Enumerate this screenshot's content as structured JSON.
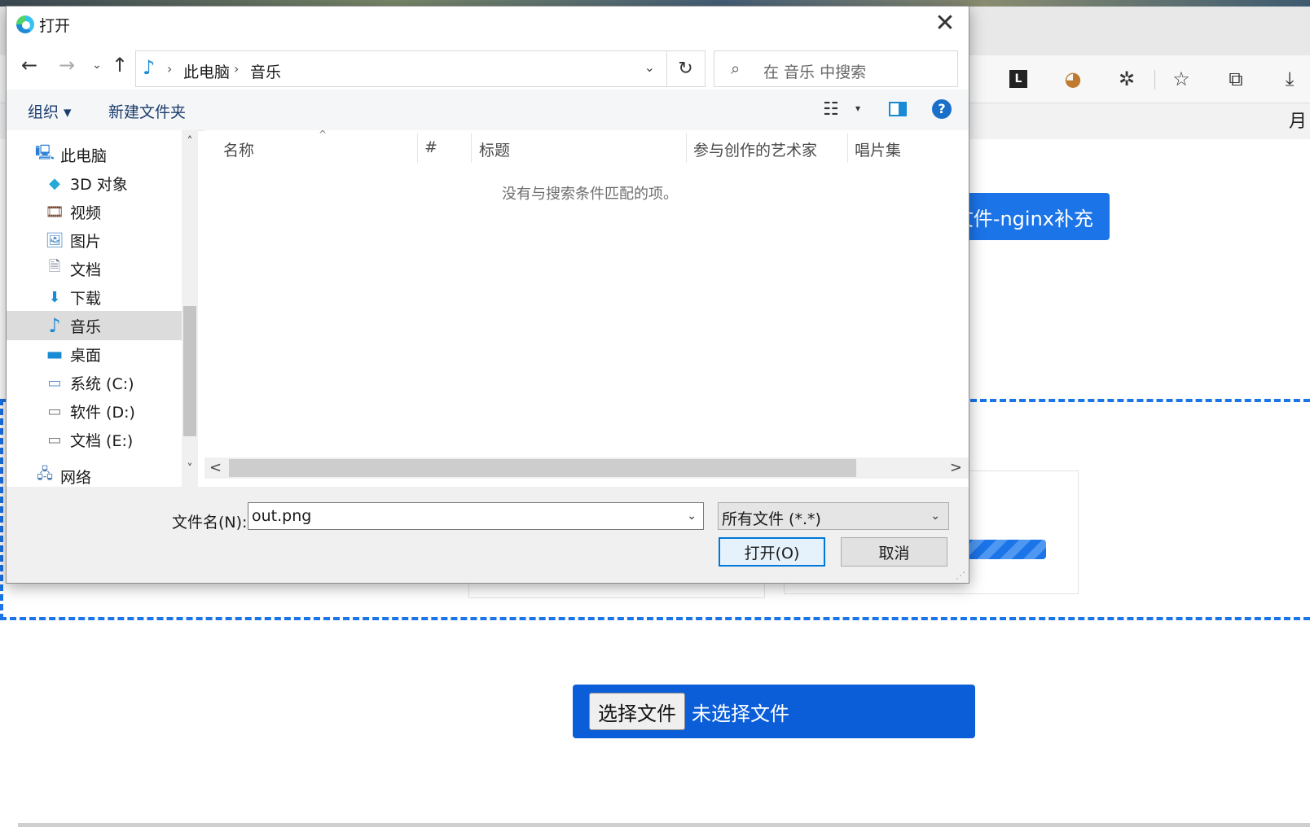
{
  "dialog": {
    "title": "打开",
    "close_glyph": "✕",
    "nav": {
      "back": "←",
      "forward": "→",
      "recent": "⌄",
      "up": "↑"
    },
    "address": {
      "location_icon": "music-note-icon",
      "breadcrumb": [
        "此电脑",
        "音乐"
      ],
      "separator": "›",
      "dropdown_glyph": "⌄"
    },
    "refresh_glyph": "↻",
    "search": {
      "icon": "⌕",
      "placeholder": "在 音乐 中搜索"
    },
    "toolbar": {
      "organize_label": "组织 ▾",
      "new_folder_label": "新建文件夹",
      "view_glyph": "☷",
      "view_dropdown_glyph": "▾",
      "help_glyph": "?"
    },
    "nav_pane": {
      "items": [
        {
          "label": "此电脑",
          "icon": "computer-icon",
          "glyph": "🖳"
        },
        {
          "label": "3D 对象",
          "icon": "cube-icon",
          "glyph": "◆"
        },
        {
          "label": "视频",
          "icon": "video-icon",
          "glyph": "🎞"
        },
        {
          "label": "图片",
          "icon": "picture-icon",
          "glyph": "🖼"
        },
        {
          "label": "文档",
          "icon": "document-icon",
          "glyph": "🗎"
        },
        {
          "label": "下载",
          "icon": "download-icon",
          "glyph": "⬇"
        },
        {
          "label": "音乐",
          "icon": "music-icon",
          "glyph": "♪",
          "selected": true
        },
        {
          "label": "桌面",
          "icon": "desktop-icon",
          "glyph": "▬"
        },
        {
          "label": "系统 (C:)",
          "icon": "drive-c-icon",
          "glyph": "▭"
        },
        {
          "label": "软件 (D:)",
          "icon": "drive-d-icon",
          "glyph": "▭"
        },
        {
          "label": "文档 (E:)",
          "icon": "drive-e-icon",
          "glyph": "▭"
        },
        {
          "label": "网络",
          "icon": "network-icon",
          "glyph": "🖧"
        }
      ],
      "scroll_up": "˄",
      "scroll_down": "˅"
    },
    "file_list": {
      "columns": [
        "名称",
        "#",
        "标题",
        "参与创作的艺术家",
        "唱片集"
      ],
      "sort_glyph": "^",
      "empty_message": "没有与搜索条件匹配的项。",
      "scroll_left": "<",
      "scroll_right": ">"
    },
    "filename_label": "文件名(N):",
    "filename_value": "out.png",
    "filetype_value": "所有文件 (*.*)",
    "dropdown_glyph": "⌄",
    "open_label": "打开(O)",
    "cancel_label": "取消",
    "resize_glyph": "⋰"
  },
  "browser": {
    "toolbar_icons": [
      {
        "name": "reading-icon",
        "glyph": "L"
      },
      {
        "name": "extension-avatar-icon",
        "glyph": "◕"
      },
      {
        "name": "extensions-icon",
        "glyph": "✲"
      },
      {
        "name": "favorites-icon",
        "glyph": "☆"
      },
      {
        "name": "collections-icon",
        "glyph": "⧉"
      },
      {
        "name": "downloads-icon",
        "glyph": "⤓"
      }
    ],
    "page_top_fragment": "月",
    "top_button_text": "文件-nginx补充",
    "choose_file_button": "选择文件",
    "no_file_text": "未选择文件"
  },
  "colors": {
    "accent": "#1b74e8",
    "upload_bg": "#0b5ed7",
    "selected_bg": "#dcdcdc"
  }
}
